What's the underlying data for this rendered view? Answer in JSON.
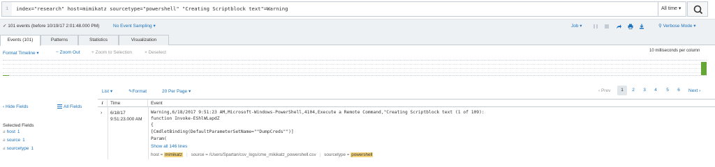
{
  "search": {
    "line_number": "1",
    "query": "index=\"research\"  host=mimikatz sourcetype=\"powershell\" \"Creating Scriptblock text\"=Warning",
    "time_range": "All time ▾"
  },
  "status": {
    "events_summary": "✓ 101 events (before 10/19/17 2:01:48.000 PM)",
    "sampling": "No Event Sampling ▾",
    "job": "Job ▾",
    "mode": "⚲ Verbose Mode ▾"
  },
  "tabs": [
    {
      "label": "Events (101)"
    },
    {
      "label": "Patterns"
    },
    {
      "label": "Statistics"
    },
    {
      "label": "Visualization"
    }
  ],
  "timeline": {
    "format": "Format Timeline ▾",
    "zoom_out": "− Zoom Out",
    "zoom_selection": "+ Zoom to Selection",
    "deselect": "× Deselect",
    "scale": "10 milliseconds per column"
  },
  "results_controls": {
    "list": "List ▾",
    "format": "✎Format",
    "per_page": "20 Per Page ▾",
    "prev": "‹ Prev",
    "pages": [
      "1",
      "2",
      "3",
      "4",
      "5",
      "6"
    ],
    "current_page": "1",
    "next": "Next ›"
  },
  "fields": {
    "hide": "‹ Hide Fields",
    "all": "All Fields",
    "selected_title": "Selected Fields",
    "selected": [
      {
        "prefix": "a",
        "name": "host",
        "count": "1"
      },
      {
        "prefix": "a",
        "name": "source",
        "count": "1"
      },
      {
        "prefix": "a",
        "name": "sourcetype",
        "count": "1"
      }
    ]
  },
  "table": {
    "headers": {
      "info": "i",
      "time": "Time",
      "event": "Event"
    },
    "rows": [
      {
        "expand": "›",
        "date": "6/18/17",
        "time": "9:51:23.000 AM",
        "lines": [
          "Warning,6/18/2017 9:51:23 AM,Microsoft-Windows-PowerShell,4104,Execute a Remote Command,\"Creating Scriptblock text (1 of 109):",
          "function Invoke-EShlWLapdZ",
          "{",
          "[CmdletBinding(DefaultParameterSetName=\"\"DumpCreds\"\")]",
          "Param("
        ],
        "show_all": "Show all 146 lines",
        "meta": {
          "host_label": "host = ",
          "host_value": "mimikatz",
          "source_label": "source = ",
          "source_value": "/Users/Spartan/csv_logs/cme_mikikatz_powershell.csv",
          "sourcetype_label": "sourcetype = ",
          "sourcetype_value": "powershell"
        }
      }
    ]
  },
  "colors": {
    "accent": "#1e73be",
    "timeline_bar": "#65a637",
    "highlight": "#f7d57d"
  },
  "icons": [
    "search-icon",
    "pause-icon",
    "stop-icon",
    "share-icon",
    "print-icon",
    "export-icon",
    "all-fields-icon"
  ]
}
